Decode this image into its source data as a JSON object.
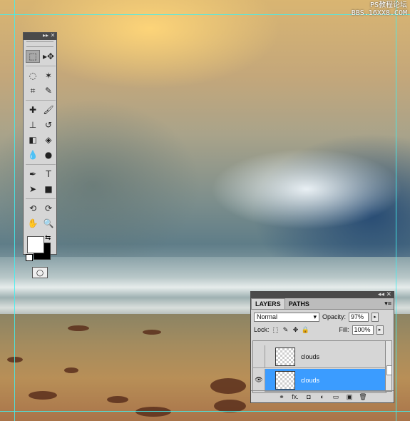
{
  "watermark": {
    "line1": "PS教程论坛",
    "line2": "BBS.16XX8.COM"
  },
  "tools_panel": {
    "header_controls": "▸▸ ✕",
    "tools": [
      {
        "name": "marquee-tool",
        "glyph": "⬚",
        "selected": true
      },
      {
        "name": "move-tool",
        "glyph": "▸✥"
      },
      {
        "name": "lasso-tool",
        "glyph": "◌"
      },
      {
        "name": "magic-wand-tool",
        "glyph": "✶"
      },
      {
        "name": "crop-tool",
        "glyph": "⌗"
      },
      {
        "name": "eyedropper-tool",
        "glyph": "✎"
      },
      {
        "name": "healing-brush-tool",
        "glyph": "✚"
      },
      {
        "name": "brush-tool",
        "glyph": "🖌"
      },
      {
        "name": "clone-stamp-tool",
        "glyph": "⊥"
      },
      {
        "name": "history-brush-tool",
        "glyph": "↺"
      },
      {
        "name": "eraser-tool",
        "glyph": "◧"
      },
      {
        "name": "paint-bucket-tool",
        "glyph": "◈"
      },
      {
        "name": "blur-tool",
        "glyph": "💧"
      },
      {
        "name": "dodge-tool",
        "glyph": "●"
      },
      {
        "name": "pen-tool",
        "glyph": "✒"
      },
      {
        "name": "type-tool",
        "glyph": "T"
      },
      {
        "name": "path-selection-tool",
        "glyph": "➤"
      },
      {
        "name": "rectangle-tool",
        "glyph": "■"
      },
      {
        "name": "3d-rotate-tool",
        "glyph": "⟲"
      },
      {
        "name": "3d-orbit-tool",
        "glyph": "⟳"
      },
      {
        "name": "hand-tool",
        "glyph": "✋"
      },
      {
        "name": "zoom-tool",
        "glyph": "🔍"
      }
    ],
    "quick_mask": "◯"
  },
  "layers_panel": {
    "header_controls": "◂◂ ✕",
    "tabs": [
      {
        "label": "LAYERS",
        "active": true
      },
      {
        "label": "PATHS",
        "active": false
      }
    ],
    "menu": "▾≡",
    "blend_mode": "Normal",
    "opacity_label": "Opacity:",
    "opacity_value": "97%",
    "lock_label": "Lock:",
    "fill_label": "Fill:",
    "fill_value": "100%",
    "layers": [
      {
        "name": "clouds",
        "visible": false,
        "selected": false
      },
      {
        "name": "clouds",
        "visible": true,
        "selected": true
      }
    ],
    "footer_icons": [
      "link-layers",
      "fx",
      "add-mask",
      "adjustment",
      "group",
      "new-layer",
      "delete"
    ],
    "footer_glyphs": [
      "⚭",
      "fx.",
      "◘",
      "◐",
      "▭",
      "▣",
      "🗑"
    ]
  }
}
